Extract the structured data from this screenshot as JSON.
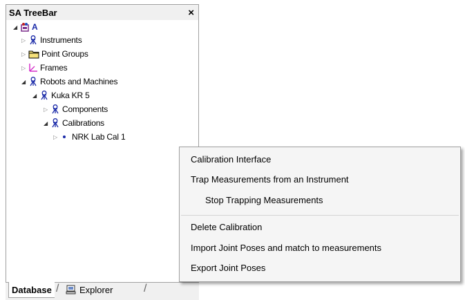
{
  "panel": {
    "title": "SA TreeBar",
    "close_glyph": "×"
  },
  "tree": {
    "root": "A",
    "instruments": "Instruments",
    "point_groups": "Point Groups",
    "frames": "Frames",
    "robots": "Robots and Machines",
    "kuka": "Kuka KR 5",
    "components": "Components",
    "calibrations": "Calibrations",
    "cal1": "NRK Lab Cal 1"
  },
  "tabs": {
    "database": "Database",
    "explorer": "Explorer"
  },
  "context_menu": {
    "items": [
      "Calibration Interface",
      "Trap Measurements from an Instrument",
      "Stop Trapping Measurements",
      "Delete Calibration",
      "Import Joint Poses and match to measurements",
      "Export Joint Poses"
    ]
  },
  "icons": {
    "root": "assembly-icon",
    "instrument": "instrument-tripod-icon",
    "folder": "folder-icon",
    "frame": "frame-axes-icon",
    "bullet": "bullet-icon",
    "explorer": "explorer-icon"
  },
  "colors": {
    "accent": "#1a2aa8",
    "folder_fill": "#f5e07a",
    "frame_axes": "#d42cc8",
    "menu_bg": "#f5f5f5"
  }
}
